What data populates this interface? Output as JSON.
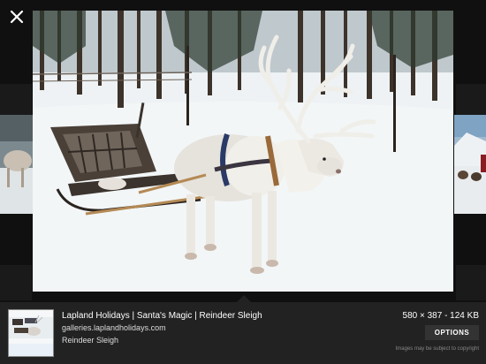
{
  "viewer": {
    "close_icon": "close-icon",
    "image_title": "Lapland Holidays | Santa's Magic | Reindeer Sleigh",
    "source_url": "galleries.laplandholidays.com",
    "description": "Reindeer Sleigh",
    "dimensions": "580 × 387 - 124 KB",
    "options_label": "OPTIONS",
    "copyright_note": "Images may be subject to copyright"
  },
  "colors": {
    "background": "#0f0f0f",
    "info_bar": "#222222",
    "options_button": "#333333"
  }
}
